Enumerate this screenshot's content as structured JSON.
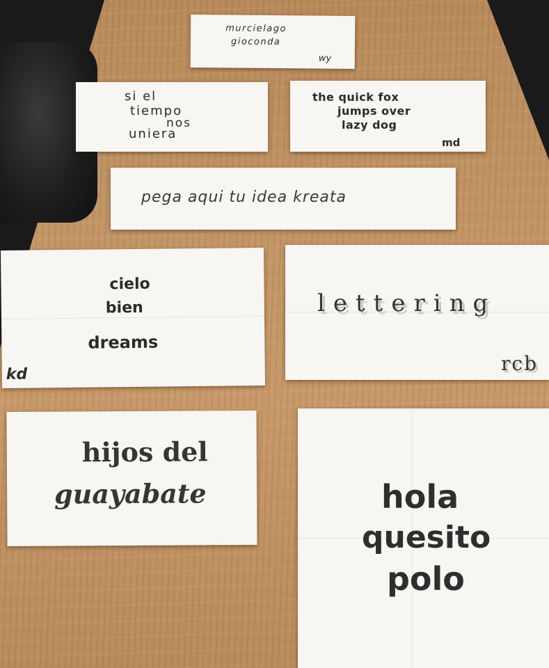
{
  "posters": {
    "murcielago": {
      "line1": "murcielago",
      "line2": "gioconda",
      "signature": "wy"
    },
    "tiempo": {
      "line1": "si el",
      "line2": "tiempo",
      "line3": "nos",
      "line4": "uniera"
    },
    "fox": {
      "line1": "the quick fox",
      "line2": "jumps over",
      "line3": "lazy dog",
      "signature": "md"
    },
    "pega": {
      "line1": "pega aqui tu idea kreata"
    },
    "cielo": {
      "line1": "cielo",
      "line2": "bien",
      "line3": "dreams",
      "signature": "kd"
    },
    "lettering": {
      "line1": "lettering",
      "signature": "rcb"
    },
    "hijos": {
      "line1": "hijos del",
      "line2": "guayabate"
    },
    "hola": {
      "line1": "hola",
      "line2": "quesito",
      "line3": "polo"
    }
  }
}
